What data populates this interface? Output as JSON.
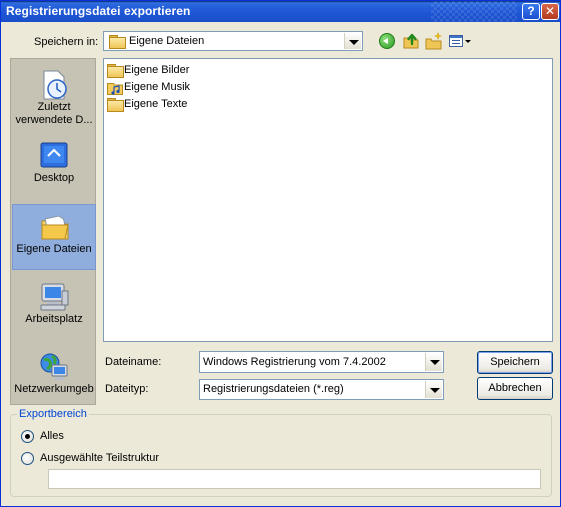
{
  "window": {
    "title": "Registrierungsdatei exportieren",
    "help_glyph": "?",
    "close_glyph": "✕"
  },
  "location": {
    "label": "Speichern in:",
    "value": "Eigene Dateien",
    "icon": "folder-icon"
  },
  "toolbar": {
    "back": "back-icon",
    "up": "up-folder-icon",
    "new_folder": "new-folder-icon",
    "views": "views-menu-icon"
  },
  "places": [
    {
      "label": "Zuletzt verwendete D...",
      "icon": "recent-documents-icon",
      "selected": false
    },
    {
      "label": "Desktop",
      "icon": "desktop-icon",
      "selected": false
    },
    {
      "label": "Eigene Dateien",
      "icon": "my-documents-icon",
      "selected": true
    },
    {
      "label": "Arbeitsplatz",
      "icon": "my-computer-icon",
      "selected": false
    },
    {
      "label": "Netzwerkumgeb",
      "icon": "network-places-icon",
      "selected": false
    }
  ],
  "files": [
    {
      "name": "Eigene Bilder",
      "icon": "folder-icon"
    },
    {
      "name": "Eigene Musik",
      "icon": "music-folder-icon"
    },
    {
      "name": "Eigene Texte",
      "icon": "folder-icon"
    }
  ],
  "filename": {
    "label": "Dateiname:",
    "value": "Windows Registrierung vom 7.4.2002"
  },
  "filetype": {
    "label": "Dateityp:",
    "value": "Registrierungsdateien (*.reg)"
  },
  "buttons": {
    "save": "Speichern",
    "cancel": "Abbrechen"
  },
  "export_range": {
    "title": "Exportbereich",
    "option_all": "Alles",
    "option_selected": "Ausgewählte Teilstruktur",
    "selected_option": "all",
    "branch_value": ""
  },
  "colors": {
    "titlebar": "#245EDB",
    "dialog_bg": "#ECE9D8",
    "selection": "#8FAEDD",
    "group_title": "#0046D5"
  }
}
